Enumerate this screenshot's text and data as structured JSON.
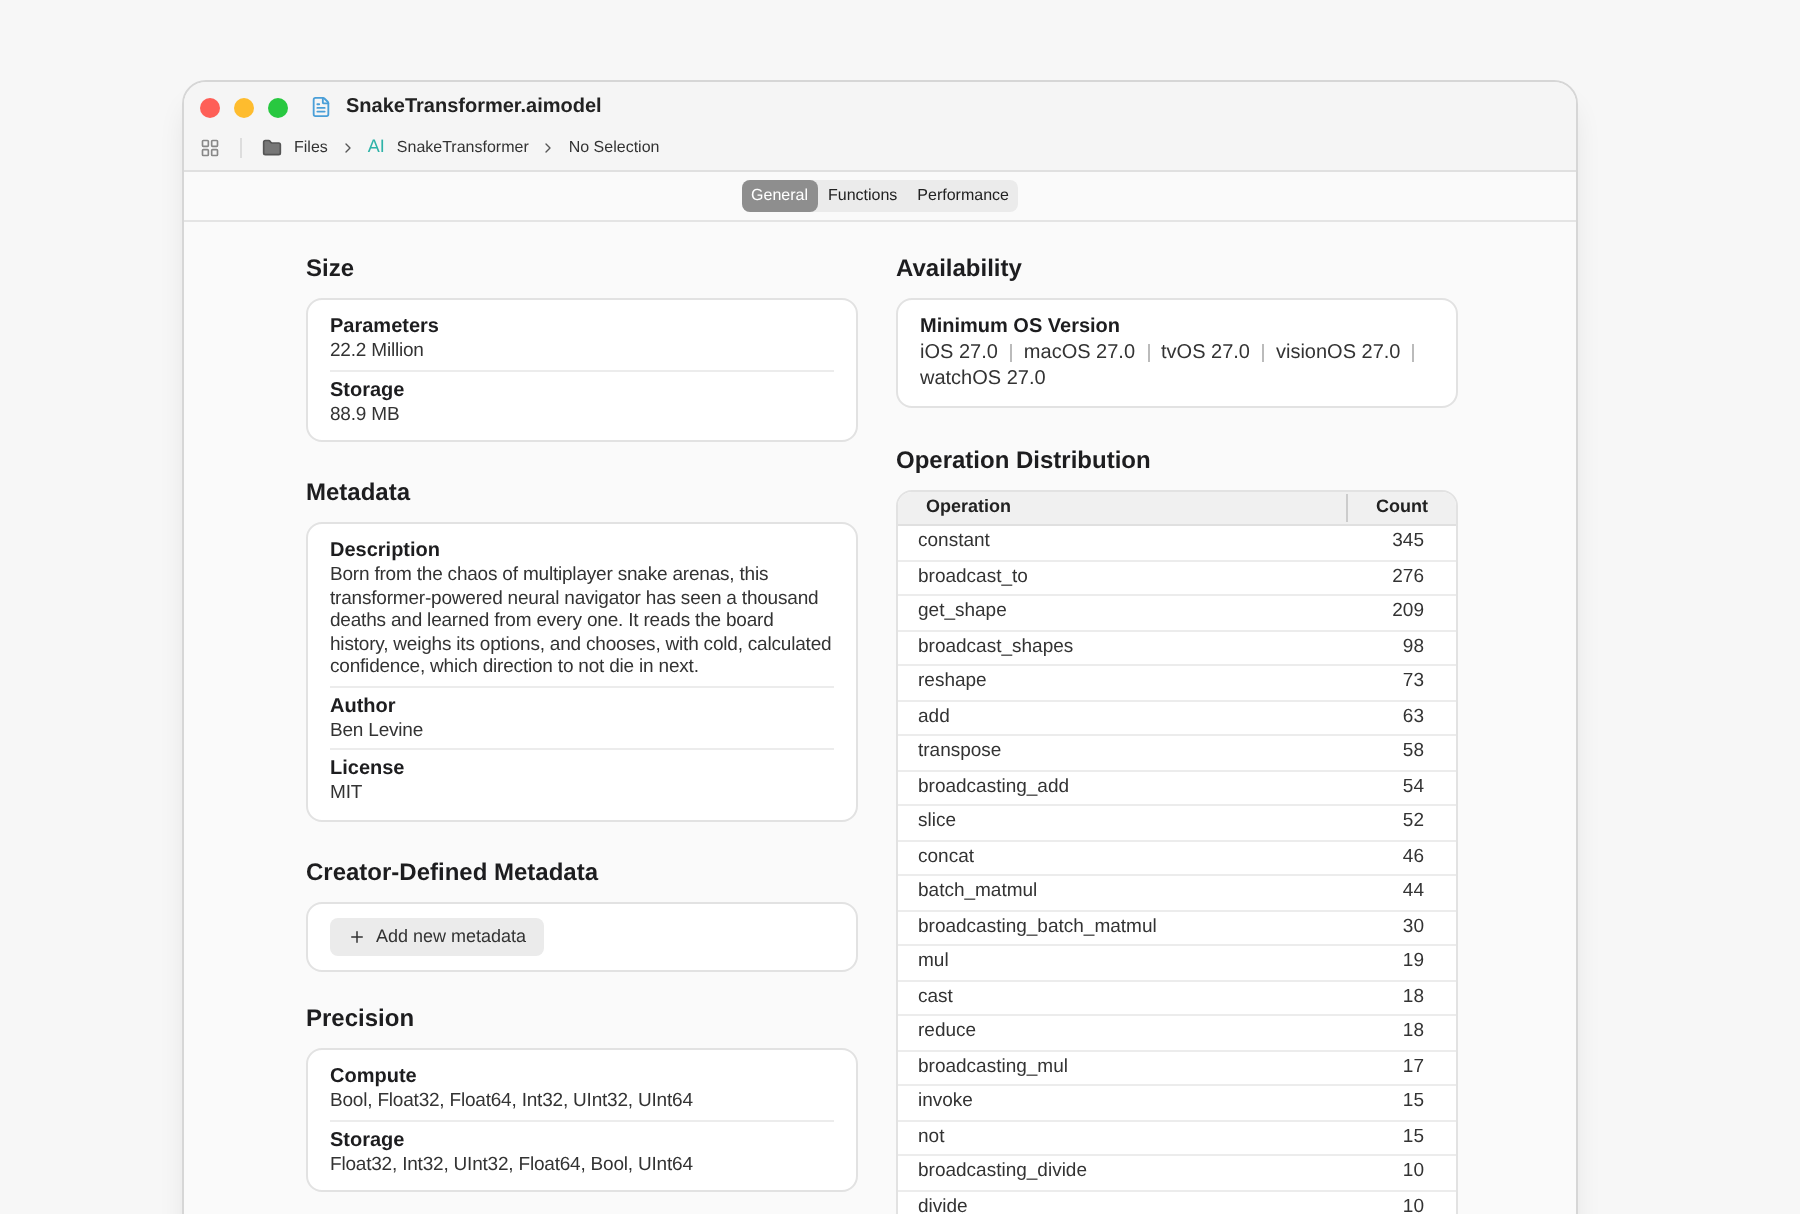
{
  "window": {
    "title": "SnakeTransformer.aimodel"
  },
  "breadcrumbs": [
    {
      "kind": "folder",
      "label": "Files"
    },
    {
      "kind": "model",
      "badge": "AI",
      "label": "SnakeTransformer"
    },
    {
      "kind": "plain",
      "label": "No Selection"
    }
  ],
  "tabs": [
    {
      "label": "General",
      "selected": true
    },
    {
      "label": "Functions",
      "selected": false
    },
    {
      "label": "Performance",
      "selected": false
    }
  ],
  "size": {
    "title": "Size",
    "fields": [
      {
        "label": "Parameters",
        "value": "22.2 Million"
      },
      {
        "label": "Storage",
        "value": "88.9 MB"
      }
    ]
  },
  "metadata": {
    "title": "Metadata",
    "fields": [
      {
        "label": "Description",
        "value": "Born from the chaos of multiplayer snake arenas, this transformer-powered neural navigator has seen a thousand deaths and learned from every one. It reads the board history, weighs its options, and chooses, with cold, calculated confidence, which direction to not die in next."
      },
      {
        "label": "Author",
        "value": "Ben Levine"
      },
      {
        "label": "License",
        "value": "MIT"
      }
    ]
  },
  "creator_metadata": {
    "title": "Creator-Defined Metadata",
    "add_button": "Add new metadata"
  },
  "precision": {
    "title": "Precision",
    "fields": [
      {
        "label": "Compute",
        "value": "Bool, Float32, Float64, Int32, UInt32, UInt64"
      },
      {
        "label": "Storage",
        "value": "Float32, Int32, UInt32, Float64, Bool, UInt64"
      }
    ]
  },
  "availability": {
    "title": "Availability",
    "label": "Minimum OS Version",
    "versions": [
      "iOS 27.0",
      "macOS 27.0",
      "tvOS 27.0",
      "visionOS 27.0",
      "watchOS 27.0"
    ]
  },
  "operation_distribution": {
    "title": "Operation Distribution",
    "columns": [
      "Operation",
      "Count"
    ],
    "rows": [
      [
        "constant",
        "345"
      ],
      [
        "broadcast_to",
        "276"
      ],
      [
        "get_shape",
        "209"
      ],
      [
        "broadcast_shapes",
        "98"
      ],
      [
        "reshape",
        "73"
      ],
      [
        "add",
        "63"
      ],
      [
        "transpose",
        "58"
      ],
      [
        "broadcasting_add",
        "54"
      ],
      [
        "slice",
        "52"
      ],
      [
        "concat",
        "46"
      ],
      [
        "batch_matmul",
        "44"
      ],
      [
        "broadcasting_batch_matmul",
        "30"
      ],
      [
        "mul",
        "19"
      ],
      [
        "cast",
        "18"
      ],
      [
        "reduce",
        "18"
      ],
      [
        "broadcasting_mul",
        "17"
      ],
      [
        "invoke",
        "15"
      ],
      [
        "not",
        "15"
      ],
      [
        "broadcasting_divide",
        "10"
      ],
      [
        "divide",
        "10"
      ]
    ]
  }
}
